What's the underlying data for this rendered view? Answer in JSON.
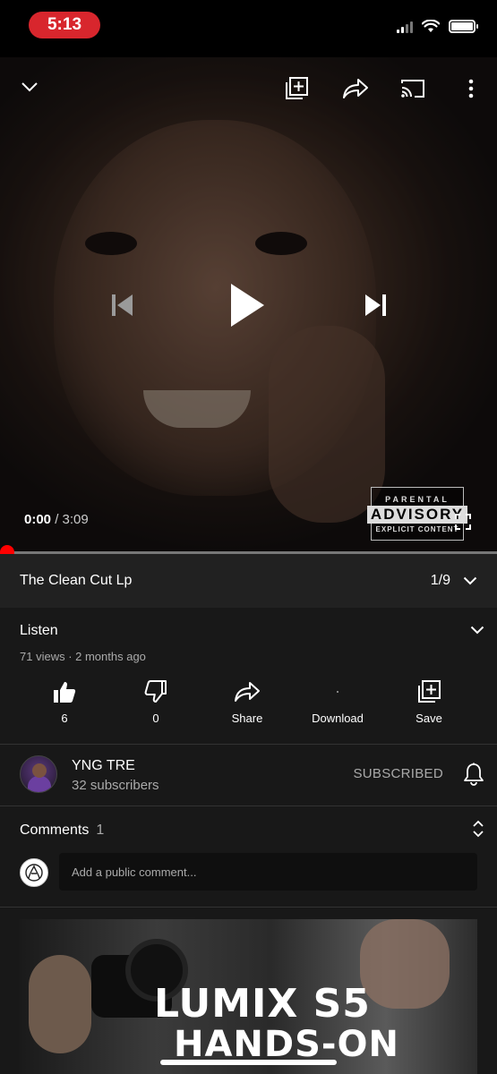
{
  "status_bar": {
    "time": "5:13"
  },
  "player": {
    "current_time": "0:00",
    "duration": "/ 3:09",
    "progress": 0.0,
    "advisory": {
      "line1": "PARENTAL",
      "line2": "ADVISORY",
      "line3": "EXPLICIT CONTENT"
    }
  },
  "playlist": {
    "title": "The Clean Cut Lp",
    "position": "1/9"
  },
  "video": {
    "title": "Listen",
    "meta": "71 views · 2 months ago",
    "actions": [
      {
        "icon": "thumbs-up-icon",
        "label": "6"
      },
      {
        "icon": "thumbs-down-icon",
        "label": "0"
      },
      {
        "icon": "share-icon",
        "label": "Share"
      },
      {
        "icon": "download-icon",
        "label": "Download"
      },
      {
        "icon": "save-icon",
        "label": "Save"
      }
    ]
  },
  "channel": {
    "name": "YNG TRE",
    "subscribers": "32 subscribers",
    "subscribe_label": "SUBSCRIBED"
  },
  "comments": {
    "label": "Comments",
    "count": "1",
    "placeholder": "Add a public comment..."
  },
  "next_video": {
    "line1": "LUMIX S5",
    "line2": "HANDS-ON"
  }
}
